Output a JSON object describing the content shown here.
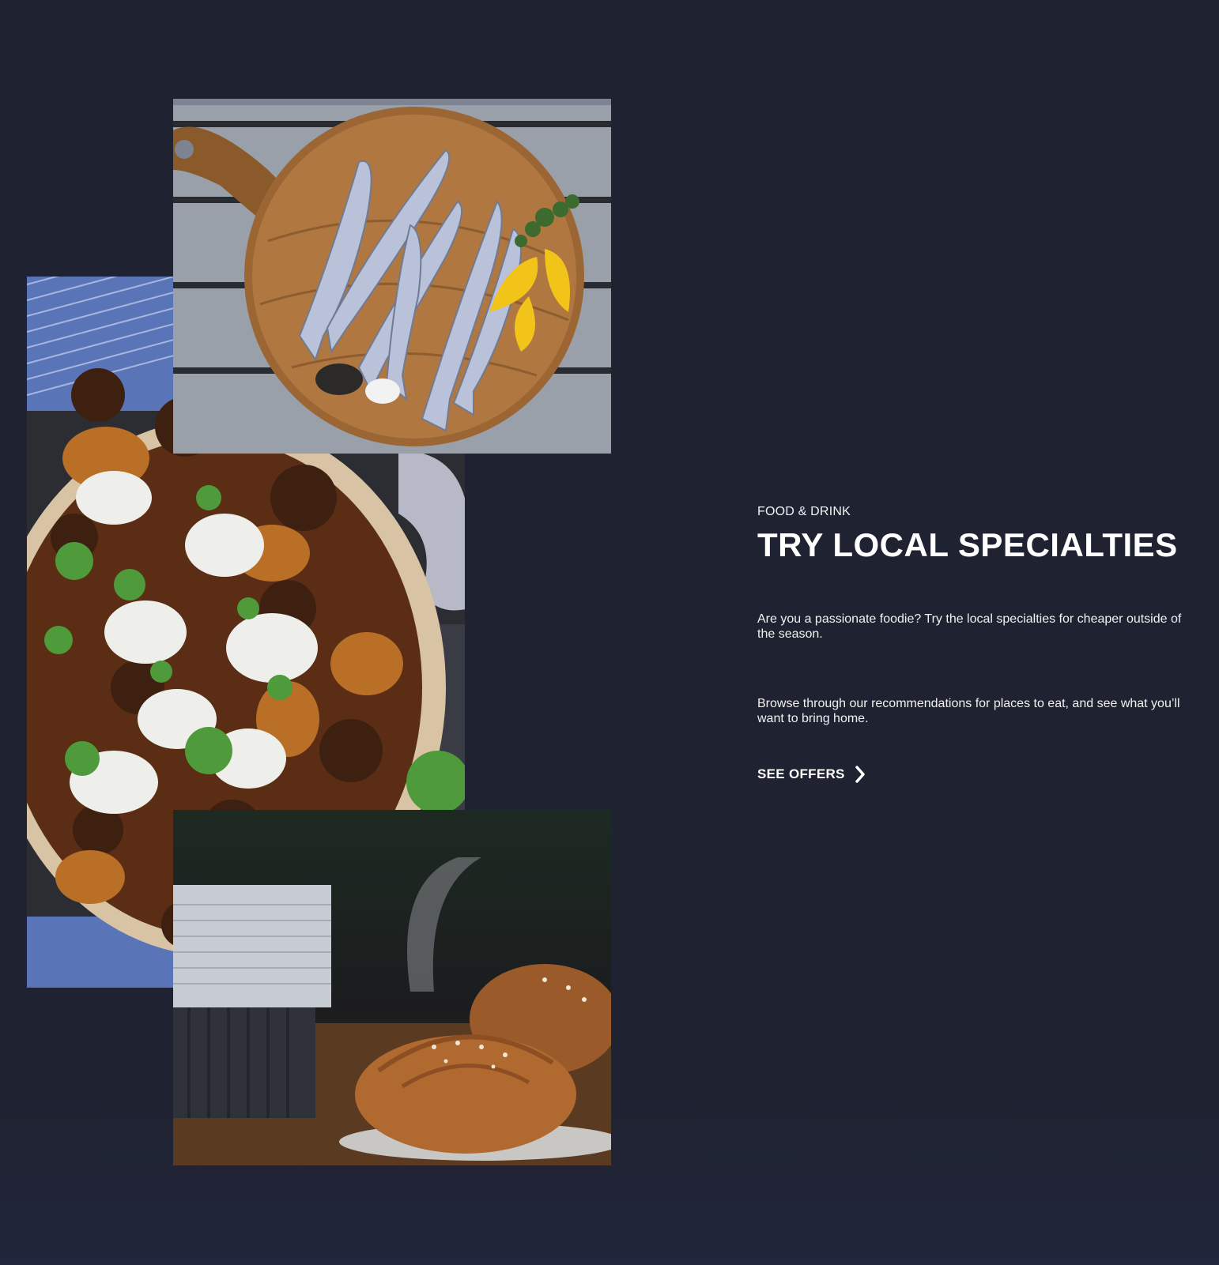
{
  "section": {
    "eyebrow": "FOOD & DRINK",
    "headline": "TRY LOCAL SPECIALTIES",
    "paragraph_1": "Are you a passionate foodie? Try the local specialties for cheaper outside of the season.",
    "paragraph_2": "Browse through our recommendations for places to eat, and see what you’ll want to bring home.",
    "cta_label": "SEE OFFERS",
    "cta_icon": "chevron-right-icon"
  },
  "images": [
    {
      "name": "fish-on-board-photo"
    },
    {
      "name": "meatball-stew-photo"
    },
    {
      "name": "coffee-and-cinnamon-bun-photo"
    }
  ],
  "colors": {
    "background": "#1f2230",
    "text": "#ffffff"
  }
}
